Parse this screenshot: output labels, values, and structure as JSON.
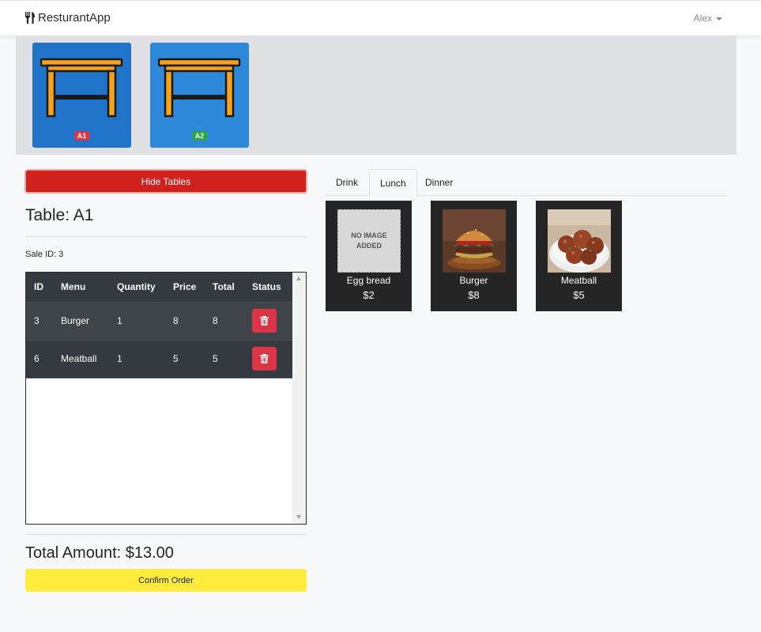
{
  "app": {
    "brand": "ResturantApp",
    "user": "Alex"
  },
  "tables": [
    {
      "label": "A1",
      "badge_color": "#dc3545",
      "color": "#1f73c8"
    },
    {
      "label": "A2",
      "badge_color": "#28a745",
      "color": "#2e89da"
    }
  ],
  "left": {
    "hide_tables_label": "Hide Tables",
    "table_title": "Table: A1",
    "sale_id": "Sale ID: 3",
    "columns": [
      "ID",
      "Menu",
      "Quantity",
      "Price",
      "Total",
      "Status"
    ],
    "rows": [
      {
        "id": "3",
        "menu": "Burger",
        "quantity": "1",
        "price": "8",
        "total": "8"
      },
      {
        "id": "6",
        "menu": "Meatball",
        "quantity": "1",
        "price": "5",
        "total": "5"
      }
    ],
    "total_amount": "Total Amount: $13.00",
    "confirm_label": "Confirm Order"
  },
  "menu": {
    "tabs": [
      "Drink",
      "Lunch",
      "Dinner"
    ],
    "active_tab": "Lunch",
    "items": [
      {
        "name": "Egg bread",
        "price": "$2",
        "image": "NO IMAGE ADDED"
      },
      {
        "name": "Burger",
        "price": "$8",
        "image": "burger"
      },
      {
        "name": "Meatball",
        "price": "$5",
        "image": "meatball"
      }
    ]
  },
  "colors": {
    "danger": "#d0211c",
    "confirm": "#ffeb3b",
    "table_dark": "#343a40"
  }
}
